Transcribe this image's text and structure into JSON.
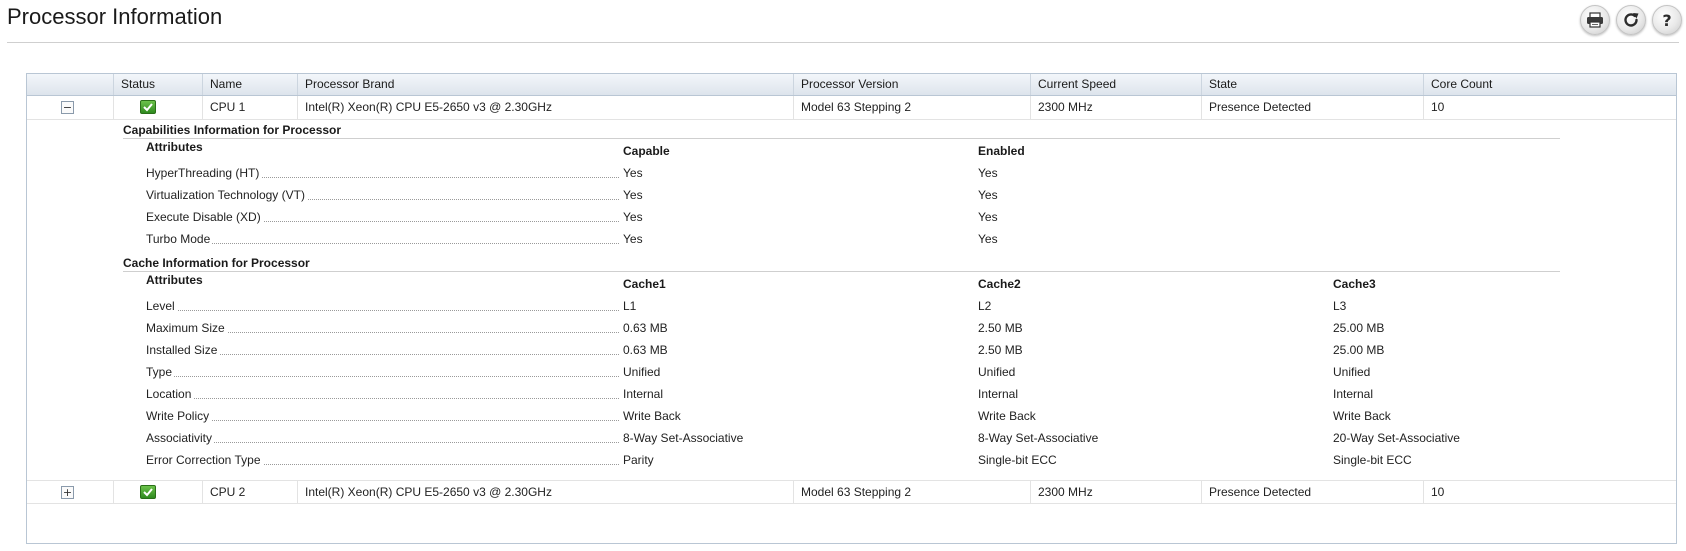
{
  "page": {
    "title": "Processor Information"
  },
  "toolbar": {
    "print_icon": "print-icon",
    "refresh_icon": "refresh-icon",
    "help_icon": "help-icon"
  },
  "grid": {
    "columns": [
      "Status",
      "Name",
      "Processor Brand",
      "Processor Version",
      "Current Speed",
      "State",
      "Core Count"
    ],
    "rows": [
      {
        "expander": "−",
        "status": "ok-check-icon",
        "name": "CPU 1",
        "brand": "Intel(R) Xeon(R) CPU E5-2650 v3 @ 2.30GHz",
        "version": "Model 63 Stepping 2",
        "speed": "2300 MHz",
        "state": "Presence Detected",
        "cores": "10",
        "expanded": true
      },
      {
        "expander": "+",
        "status": "ok-check-icon",
        "name": "CPU 2",
        "brand": "Intel(R) Xeon(R) CPU E5-2650 v3 @ 2.30GHz",
        "version": "Model 63 Stepping 2",
        "speed": "2300 MHz",
        "state": "Presence Detected",
        "cores": "10",
        "expanded": false
      }
    ]
  },
  "capabilities": {
    "title": "Capabilities Information for Processor",
    "attributes_label": "Attributes",
    "columns": [
      "Capable",
      "Enabled"
    ],
    "rows": [
      {
        "label": "HyperThreading (HT)",
        "values": [
          "Yes",
          "Yes"
        ]
      },
      {
        "label": "Virtualization Technology (VT)",
        "values": [
          "Yes",
          "Yes"
        ]
      },
      {
        "label": "Execute Disable (XD)",
        "values": [
          "Yes",
          "Yes"
        ]
      },
      {
        "label": "Turbo Mode",
        "values": [
          "Yes",
          "Yes"
        ]
      }
    ]
  },
  "cache": {
    "title": "Cache Information for Processor",
    "attributes_label": "Attributes",
    "columns": [
      "Cache1",
      "Cache2",
      "Cache3"
    ],
    "rows": [
      {
        "label": "Level",
        "values": [
          "L1",
          "L2",
          "L3"
        ]
      },
      {
        "label": "Maximum Size",
        "values": [
          "0.63 MB",
          "2.50 MB",
          "25.00 MB"
        ]
      },
      {
        "label": "Installed Size",
        "values": [
          "0.63 MB",
          "2.50 MB",
          "25.00 MB"
        ]
      },
      {
        "label": "Type",
        "values": [
          "Unified",
          "Unified",
          "Unified"
        ]
      },
      {
        "label": "Location",
        "values": [
          "Internal",
          "Internal",
          "Internal"
        ]
      },
      {
        "label": "Write Policy",
        "values": [
          "Write Back",
          "Write Back",
          "Write Back"
        ]
      },
      {
        "label": "Associativity",
        "values": [
          "8-Way Set-Associative",
          "8-Way Set-Associative",
          "20-Way Set-Associative"
        ]
      },
      {
        "label": "Error Correction Type",
        "values": [
          "Parity",
          "Single-bit ECC",
          "Single-bit ECC"
        ]
      }
    ]
  },
  "colors": {
    "header_bg": "#dde4ec",
    "border": "#b9c6d4",
    "status_ok": "#3b9a2a"
  }
}
